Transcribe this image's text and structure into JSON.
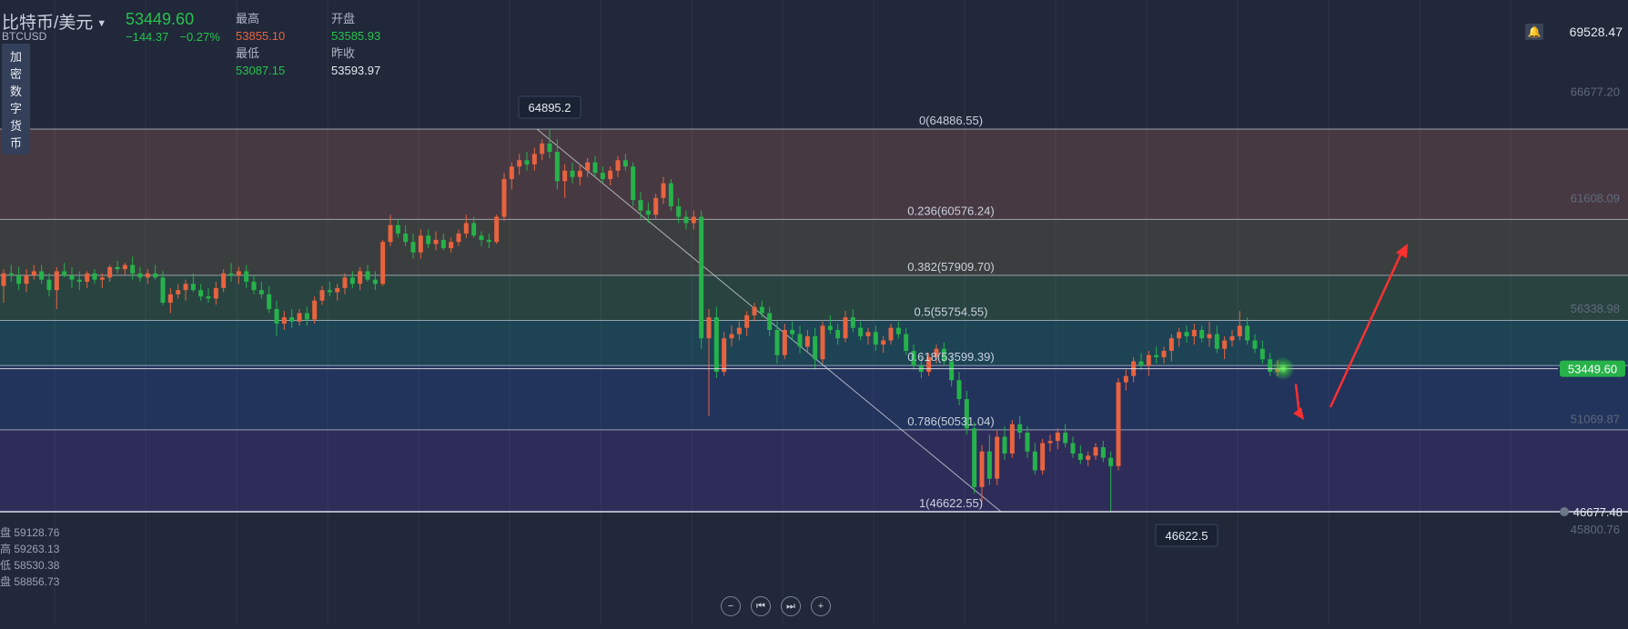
{
  "header": {
    "symbol_name": "比特币/美元",
    "symbol_code": "BTCUSD",
    "price": "53449.60",
    "change": "−144.37",
    "change_pct": "−0.27%",
    "high_label": "最高",
    "high_value": "53855.10",
    "open_label": "开盘",
    "open_value": "53585.93",
    "low_label": "最低",
    "low_value": "53087.15",
    "prev_close_label": "昨收",
    "prev_close_value": "53593.97",
    "category_tag": "加密数字货币",
    "top_right_value": "69528.47"
  },
  "bottom_left_ohlc": [
    {
      "k": "盘",
      "v": "59128.76"
    },
    {
      "k": "高",
      "v": "59263.13"
    },
    {
      "k": "低",
      "v": "58530.38"
    },
    {
      "k": "盘",
      "v": "58856.73"
    }
  ],
  "colors": {
    "up": "#e8633f",
    "down": "#26b24b",
    "price_badge": "#27b24a",
    "background": "#20283a",
    "arrow": "#ff3030"
  },
  "chart_data": {
    "type": "candlestick",
    "y_ticks": [
      66677.2,
      61608.09,
      56338.98,
      51069.87,
      45800.76
    ],
    "y_range": [
      44900,
      69900
    ],
    "current_price": 53449.6,
    "current_price_label": "53449.60",
    "low_line_label": "46677.48",
    "annotations": [
      {
        "label": "64895.2"
      },
      {
        "label": "46622.5"
      }
    ],
    "fib_levels": [
      {
        "label": "0(64886.55)",
        "price": 64886.55,
        "fill": "#4a3a42"
      },
      {
        "label": "0.236(60576.24)",
        "price": 60576.24,
        "fill": "#3d3f3e"
      },
      {
        "label": "0.382(57909.70)",
        "price": 57909.7,
        "fill": "#2a4541"
      },
      {
        "label": "0.5(55754.55)",
        "price": 55754.55,
        "fill": "#1e4456"
      },
      {
        "label": "0.618(53599.39)",
        "price": 53599.39,
        "fill": "#23345e"
      },
      {
        "label": "0.786(50531.04)",
        "price": 50531.04,
        "fill": "#2f2d5c"
      },
      {
        "label": "1(46622.55)",
        "price": 46622.55,
        "fill": null
      }
    ],
    "candles": [
      {
        "o": 57400,
        "h": 58200,
        "l": 56600,
        "c": 58000
      },
      {
        "o": 58000,
        "h": 58400,
        "l": 57600,
        "c": 57900
      },
      {
        "o": 57900,
        "h": 58300,
        "l": 57200,
        "c": 57500
      },
      {
        "o": 57500,
        "h": 58200,
        "l": 57100,
        "c": 57900
      },
      {
        "o": 57900,
        "h": 58400,
        "l": 57700,
        "c": 58100
      },
      {
        "o": 58100,
        "h": 58400,
        "l": 57500,
        "c": 57700
      },
      {
        "o": 57700,
        "h": 58000,
        "l": 56900,
        "c": 57200
      },
      {
        "o": 57200,
        "h": 58300,
        "l": 56300,
        "c": 58100
      },
      {
        "o": 58100,
        "h": 58500,
        "l": 57800,
        "c": 57900
      },
      {
        "o": 57900,
        "h": 58300,
        "l": 57300,
        "c": 57700
      },
      {
        "o": 57700,
        "h": 58100,
        "l": 57200,
        "c": 57600
      },
      {
        "o": 57600,
        "h": 58100,
        "l": 57300,
        "c": 58000
      },
      {
        "o": 58000,
        "h": 58200,
        "l": 57500,
        "c": 57700
      },
      {
        "o": 57700,
        "h": 58000,
        "l": 57300,
        "c": 57800
      },
      {
        "o": 57800,
        "h": 58400,
        "l": 57600,
        "c": 58300
      },
      {
        "o": 58300,
        "h": 58600,
        "l": 58000,
        "c": 58200
      },
      {
        "o": 58200,
        "h": 58500,
        "l": 57900,
        "c": 58400
      },
      {
        "o": 58400,
        "h": 58800,
        "l": 57700,
        "c": 58000
      },
      {
        "o": 58000,
        "h": 58300,
        "l": 57600,
        "c": 57800
      },
      {
        "o": 57800,
        "h": 58200,
        "l": 57500,
        "c": 58000
      },
      {
        "o": 58000,
        "h": 58400,
        "l": 57700,
        "c": 57800
      },
      {
        "o": 57800,
        "h": 58100,
        "l": 56500,
        "c": 56600
      },
      {
        "o": 56600,
        "h": 57300,
        "l": 56100,
        "c": 57000
      },
      {
        "o": 57000,
        "h": 57500,
        "l": 56800,
        "c": 57200
      },
      {
        "o": 57200,
        "h": 57700,
        "l": 56700,
        "c": 57500
      },
      {
        "o": 57500,
        "h": 58000,
        "l": 57100,
        "c": 57200
      },
      {
        "o": 57200,
        "h": 57500,
        "l": 56700,
        "c": 56900
      },
      {
        "o": 56900,
        "h": 57300,
        "l": 56600,
        "c": 56800
      },
      {
        "o": 56800,
        "h": 57600,
        "l": 56500,
        "c": 57300
      },
      {
        "o": 57300,
        "h": 58200,
        "l": 57100,
        "c": 58000
      },
      {
        "o": 58000,
        "h": 58500,
        "l": 57600,
        "c": 57900
      },
      {
        "o": 57900,
        "h": 58300,
        "l": 57500,
        "c": 58100
      },
      {
        "o": 58100,
        "h": 58400,
        "l": 57300,
        "c": 57600
      },
      {
        "o": 57600,
        "h": 57900,
        "l": 57000,
        "c": 57200
      },
      {
        "o": 57200,
        "h": 57600,
        "l": 56800,
        "c": 57000
      },
      {
        "o": 57000,
        "h": 57400,
        "l": 56100,
        "c": 56300
      },
      {
        "o": 56300,
        "h": 56700,
        "l": 55000,
        "c": 55600
      },
      {
        "o": 55600,
        "h": 56200,
        "l": 55300,
        "c": 55900
      },
      {
        "o": 55900,
        "h": 56300,
        "l": 55400,
        "c": 55700
      },
      {
        "o": 55700,
        "h": 56300,
        "l": 55500,
        "c": 56100
      },
      {
        "o": 56100,
        "h": 56400,
        "l": 55500,
        "c": 55800
      },
      {
        "o": 55800,
        "h": 56900,
        "l": 55600,
        "c": 56700
      },
      {
        "o": 56700,
        "h": 57400,
        "l": 56500,
        "c": 57200
      },
      {
        "o": 57200,
        "h": 57600,
        "l": 56900,
        "c": 57100
      },
      {
        "o": 57100,
        "h": 57500,
        "l": 56700,
        "c": 57300
      },
      {
        "o": 57300,
        "h": 58000,
        "l": 57000,
        "c": 57800
      },
      {
        "o": 57800,
        "h": 58100,
        "l": 57300,
        "c": 57500
      },
      {
        "o": 57500,
        "h": 58300,
        "l": 57200,
        "c": 58100
      },
      {
        "o": 58100,
        "h": 58400,
        "l": 57600,
        "c": 57700
      },
      {
        "o": 57700,
        "h": 58100,
        "l": 57200,
        "c": 57500
      },
      {
        "o": 57500,
        "h": 59600,
        "l": 57400,
        "c": 59500
      },
      {
        "o": 59500,
        "h": 60800,
        "l": 59300,
        "c": 60300
      },
      {
        "o": 60300,
        "h": 60600,
        "l": 59700,
        "c": 59900
      },
      {
        "o": 59900,
        "h": 60300,
        "l": 59300,
        "c": 59500
      },
      {
        "o": 59500,
        "h": 59900,
        "l": 58700,
        "c": 59000
      },
      {
        "o": 59000,
        "h": 60100,
        "l": 58700,
        "c": 59800
      },
      {
        "o": 59800,
        "h": 60100,
        "l": 59200,
        "c": 59400
      },
      {
        "o": 59400,
        "h": 60000,
        "l": 59100,
        "c": 59600
      },
      {
        "o": 59600,
        "h": 59900,
        "l": 59100,
        "c": 59200
      },
      {
        "o": 59200,
        "h": 59700,
        "l": 59000,
        "c": 59500
      },
      {
        "o": 59500,
        "h": 60100,
        "l": 59300,
        "c": 59900
      },
      {
        "o": 59900,
        "h": 60800,
        "l": 59700,
        "c": 60400
      },
      {
        "o": 60400,
        "h": 60700,
        "l": 59700,
        "c": 59800
      },
      {
        "o": 59800,
        "h": 60000,
        "l": 59300,
        "c": 59600
      },
      {
        "o": 59600,
        "h": 59900,
        "l": 59200,
        "c": 59500
      },
      {
        "o": 59500,
        "h": 60800,
        "l": 59400,
        "c": 60700
      },
      {
        "o": 60700,
        "h": 62800,
        "l": 60500,
        "c": 62500
      },
      {
        "o": 62500,
        "h": 63300,
        "l": 62000,
        "c": 63100
      },
      {
        "o": 63100,
        "h": 63700,
        "l": 62700,
        "c": 63400
      },
      {
        "o": 63400,
        "h": 63800,
        "l": 62900,
        "c": 63200
      },
      {
        "o": 63200,
        "h": 64000,
        "l": 62900,
        "c": 63700
      },
      {
        "o": 63700,
        "h": 64400,
        "l": 63400,
        "c": 64200
      },
      {
        "o": 64200,
        "h": 64896,
        "l": 63500,
        "c": 63800
      },
      {
        "o": 63800,
        "h": 64400,
        "l": 62000,
        "c": 62400
      },
      {
        "o": 62400,
        "h": 63200,
        "l": 61600,
        "c": 62900
      },
      {
        "o": 62900,
        "h": 63300,
        "l": 62300,
        "c": 62600
      },
      {
        "o": 62600,
        "h": 63200,
        "l": 62200,
        "c": 62900
      },
      {
        "o": 62900,
        "h": 63500,
        "l": 62600,
        "c": 63300
      },
      {
        "o": 63300,
        "h": 63600,
        "l": 62600,
        "c": 62800
      },
      {
        "o": 62800,
        "h": 63100,
        "l": 62300,
        "c": 62500
      },
      {
        "o": 62500,
        "h": 63100,
        "l": 62200,
        "c": 62900
      },
      {
        "o": 62900,
        "h": 63600,
        "l": 62600,
        "c": 63400
      },
      {
        "o": 63400,
        "h": 63700,
        "l": 62900,
        "c": 63100
      },
      {
        "o": 63100,
        "h": 63300,
        "l": 61200,
        "c": 61500
      },
      {
        "o": 61500,
        "h": 61900,
        "l": 60600,
        "c": 61000
      },
      {
        "o": 61000,
        "h": 61400,
        "l": 60400,
        "c": 60800
      },
      {
        "o": 60800,
        "h": 61800,
        "l": 60600,
        "c": 61600
      },
      {
        "o": 61600,
        "h": 62600,
        "l": 61300,
        "c": 62300
      },
      {
        "o": 62300,
        "h": 62500,
        "l": 61000,
        "c": 61200
      },
      {
        "o": 61200,
        "h": 61600,
        "l": 60400,
        "c": 60700
      },
      {
        "o": 60700,
        "h": 61000,
        "l": 60100,
        "c": 60400
      },
      {
        "o": 60400,
        "h": 61000,
        "l": 60100,
        "c": 60700
      },
      {
        "o": 60700,
        "h": 61000,
        "l": 54400,
        "c": 54900
      },
      {
        "o": 54900,
        "h": 56300,
        "l": 51200,
        "c": 55900
      },
      {
        "o": 55900,
        "h": 56400,
        "l": 53000,
        "c": 53300
      },
      {
        "o": 53300,
        "h": 55200,
        "l": 53100,
        "c": 54900
      },
      {
        "o": 54900,
        "h": 55500,
        "l": 54500,
        "c": 55100
      },
      {
        "o": 55100,
        "h": 55700,
        "l": 54800,
        "c": 55400
      },
      {
        "o": 55400,
        "h": 56200,
        "l": 55000,
        "c": 56000
      },
      {
        "o": 56000,
        "h": 56600,
        "l": 55700,
        "c": 56400
      },
      {
        "o": 56400,
        "h": 56700,
        "l": 55900,
        "c": 56100
      },
      {
        "o": 56100,
        "h": 56400,
        "l": 55000,
        "c": 55300
      },
      {
        "o": 55300,
        "h": 55700,
        "l": 53700,
        "c": 54100
      },
      {
        "o": 54100,
        "h": 55600,
        "l": 53900,
        "c": 55300
      },
      {
        "o": 55300,
        "h": 55700,
        "l": 54800,
        "c": 55100
      },
      {
        "o": 55100,
        "h": 55500,
        "l": 54200,
        "c": 54500
      },
      {
        "o": 54500,
        "h": 55300,
        "l": 54200,
        "c": 55000
      },
      {
        "o": 55000,
        "h": 55400,
        "l": 53400,
        "c": 53900
      },
      {
        "o": 53900,
        "h": 55700,
        "l": 53700,
        "c": 55500
      },
      {
        "o": 55500,
        "h": 56000,
        "l": 55100,
        "c": 55300
      },
      {
        "o": 55300,
        "h": 55600,
        "l": 54600,
        "c": 54900
      },
      {
        "o": 54900,
        "h": 56200,
        "l": 54700,
        "c": 55900
      },
      {
        "o": 55900,
        "h": 56300,
        "l": 55200,
        "c": 55400
      },
      {
        "o": 55400,
        "h": 55700,
        "l": 54800,
        "c": 55000
      },
      {
        "o": 55000,
        "h": 55400,
        "l": 54600,
        "c": 55200
      },
      {
        "o": 55200,
        "h": 55500,
        "l": 54300,
        "c": 54600
      },
      {
        "o": 54600,
        "h": 55000,
        "l": 54200,
        "c": 54800
      },
      {
        "o": 54800,
        "h": 55600,
        "l": 54600,
        "c": 55400
      },
      {
        "o": 55400,
        "h": 55700,
        "l": 54900,
        "c": 55100
      },
      {
        "o": 55100,
        "h": 55400,
        "l": 54100,
        "c": 54300
      },
      {
        "o": 54300,
        "h": 54600,
        "l": 53400,
        "c": 53600
      },
      {
        "o": 53600,
        "h": 54000,
        "l": 53000,
        "c": 53300
      },
      {
        "o": 53300,
        "h": 54200,
        "l": 53100,
        "c": 54000
      },
      {
        "o": 54000,
        "h": 54600,
        "l": 53700,
        "c": 54400
      },
      {
        "o": 54400,
        "h": 54700,
        "l": 53600,
        "c": 53800
      },
      {
        "o": 53800,
        "h": 54100,
        "l": 52600,
        "c": 52900
      },
      {
        "o": 52900,
        "h": 53300,
        "l": 51700,
        "c": 52000
      },
      {
        "o": 52000,
        "h": 52400,
        "l": 50300,
        "c": 50600
      },
      {
        "o": 50600,
        "h": 50900,
        "l": 47500,
        "c": 47800
      },
      {
        "o": 47800,
        "h": 49800,
        "l": 47100,
        "c": 49500
      },
      {
        "o": 49500,
        "h": 50300,
        "l": 47900,
        "c": 48200
      },
      {
        "o": 48200,
        "h": 50500,
        "l": 47900,
        "c": 50200
      },
      {
        "o": 50200,
        "h": 50700,
        "l": 49100,
        "c": 49400
      },
      {
        "o": 49400,
        "h": 51000,
        "l": 49200,
        "c": 50800
      },
      {
        "o": 50800,
        "h": 51200,
        "l": 50100,
        "c": 50400
      },
      {
        "o": 50400,
        "h": 50700,
        "l": 49200,
        "c": 49500
      },
      {
        "o": 49500,
        "h": 49900,
        "l": 48400,
        "c": 48600
      },
      {
        "o": 48600,
        "h": 50100,
        "l": 48400,
        "c": 49900
      },
      {
        "o": 49900,
        "h": 50300,
        "l": 49500,
        "c": 50000
      },
      {
        "o": 50000,
        "h": 50600,
        "l": 49600,
        "c": 50400
      },
      {
        "o": 50400,
        "h": 50800,
        "l": 49700,
        "c": 49900
      },
      {
        "o": 49900,
        "h": 50200,
        "l": 49200,
        "c": 49400
      },
      {
        "o": 49400,
        "h": 49800,
        "l": 48900,
        "c": 49100
      },
      {
        "o": 49100,
        "h": 49500,
        "l": 48800,
        "c": 49300
      },
      {
        "o": 49300,
        "h": 49900,
        "l": 49100,
        "c": 49700
      },
      {
        "o": 49700,
        "h": 50000,
        "l": 49000,
        "c": 49200
      },
      {
        "o": 49200,
        "h": 49500,
        "l": 46622,
        "c": 48800
      },
      {
        "o": 48800,
        "h": 53000,
        "l": 48600,
        "c": 52800
      },
      {
        "o": 52800,
        "h": 53400,
        "l": 52400,
        "c": 53100
      },
      {
        "o": 53100,
        "h": 54000,
        "l": 52800,
        "c": 53800
      },
      {
        "o": 53800,
        "h": 54200,
        "l": 53400,
        "c": 53600
      },
      {
        "o": 53600,
        "h": 54300,
        "l": 53100,
        "c": 54100
      },
      {
        "o": 54100,
        "h": 54500,
        "l": 53700,
        "c": 54000
      },
      {
        "o": 54000,
        "h": 54500,
        "l": 53700,
        "c": 54300
      },
      {
        "o": 54300,
        "h": 55100,
        "l": 53800,
        "c": 54900
      },
      {
        "o": 54900,
        "h": 55400,
        "l": 54500,
        "c": 55200
      },
      {
        "o": 55200,
        "h": 55500,
        "l": 54700,
        "c": 55000
      },
      {
        "o": 55000,
        "h": 55600,
        "l": 54600,
        "c": 55300
      },
      {
        "o": 55300,
        "h": 55500,
        "l": 54700,
        "c": 54900
      },
      {
        "o": 54900,
        "h": 55700,
        "l": 54500,
        "c": 55100
      },
      {
        "o": 55100,
        "h": 55500,
        "l": 54200,
        "c": 54400
      },
      {
        "o": 54400,
        "h": 55000,
        "l": 53900,
        "c": 54800
      },
      {
        "o": 54800,
        "h": 55300,
        "l": 54500,
        "c": 55000
      },
      {
        "o": 55000,
        "h": 56200,
        "l": 54800,
        "c": 55500
      },
      {
        "o": 55500,
        "h": 55900,
        "l": 54600,
        "c": 54800
      },
      {
        "o": 54800,
        "h": 55100,
        "l": 54200,
        "c": 54400
      },
      {
        "o": 54400,
        "h": 54800,
        "l": 53700,
        "c": 53900
      },
      {
        "o": 53900,
        "h": 54200,
        "l": 53100,
        "c": 53300
      },
      {
        "o": 53300,
        "h": 53855,
        "l": 53087,
        "c": 53449.6
      }
    ]
  }
}
